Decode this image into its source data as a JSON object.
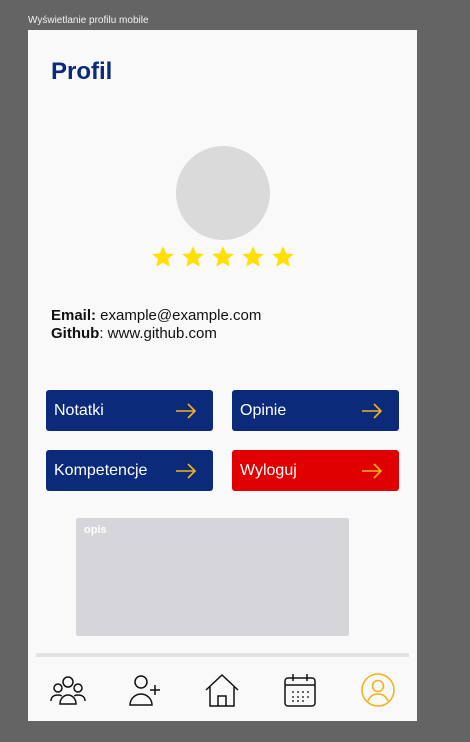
{
  "frame_label": "Wyświetlanie profilu mobile",
  "header": {
    "title": "Profil"
  },
  "rating": {
    "stars": 5,
    "max": 5,
    "color": "#ffe000"
  },
  "info": {
    "email_label": "Email:",
    "email_value": " example@example.com",
    "github_label": "Github",
    "github_value": ": www.github.com"
  },
  "buttons": {
    "notes": "Notatki",
    "reviews": "Opinie",
    "skills": "Kompetencje",
    "logout": "Wyloguj"
  },
  "description": {
    "label": "opis"
  },
  "nav": {
    "items": [
      "group-icon",
      "add-user-icon",
      "home-icon",
      "calendar-icon",
      "profile-icon"
    ],
    "active": "profile-icon",
    "active_color": "#f2b31d"
  },
  "colors": {
    "primary": "#0b2a7a",
    "danger": "#e00000",
    "arrow": "#f2b31d"
  }
}
